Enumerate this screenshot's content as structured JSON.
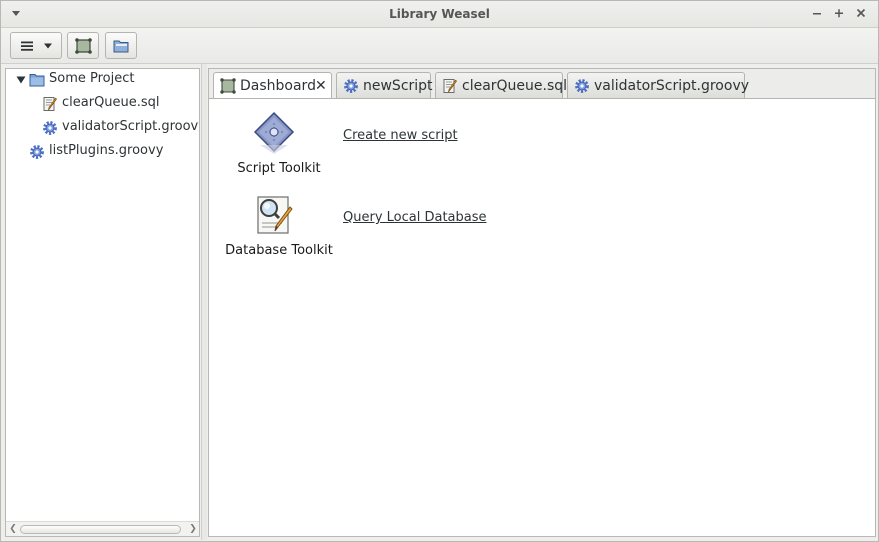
{
  "window": {
    "title": "Library Weasel"
  },
  "toolbar": {
    "buttons": [
      {
        "icon": "hamburger-menu-icon"
      },
      {
        "icon": "plugin-icon"
      },
      {
        "icon": "open-folder-icon"
      }
    ]
  },
  "tree": {
    "project": {
      "label": "Some Project",
      "expanded": true,
      "icon": "folder-icon"
    },
    "children": [
      {
        "label": "clearQueue.sql",
        "icon": "sql-script-icon"
      },
      {
        "label": "validatorScript.groovy",
        "icon": "gear-script-icon"
      }
    ],
    "root_items": [
      {
        "label": "listPlugins.groovy",
        "icon": "gear-script-icon"
      }
    ]
  },
  "tabs": [
    {
      "label": "Dashboard",
      "icon": "dashboard-icon",
      "active": true,
      "closable": true
    },
    {
      "label": "newScript",
      "icon": "gear-script-icon",
      "active": false
    },
    {
      "label": "clearQueue.sql",
      "icon": "sql-script-icon",
      "active": false
    },
    {
      "label": "validatorScript.groovy",
      "icon": "gear-script-icon",
      "active": false
    }
  ],
  "tab_close_glyph": "✕",
  "dashboard": {
    "script_toolkit": {
      "label": "Script Toolkit",
      "link": "Create new script",
      "icon": "script-toolkit-icon"
    },
    "database_toolkit": {
      "label": "Database Toolkit",
      "link": "Query Local Database",
      "icon": "database-toolkit-icon"
    }
  },
  "colors": {
    "gear_blue": "#4a6fc4",
    "folder_blue": "#6f9bd6"
  }
}
